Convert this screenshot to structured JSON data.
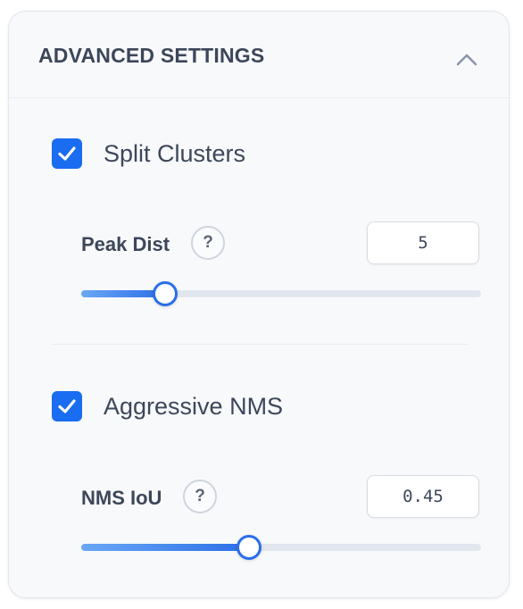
{
  "panel": {
    "title": "ADVANCED SETTINGS",
    "collapse_icon": "chevron-up-icon"
  },
  "split_clusters": {
    "label": "Split Clusters",
    "checked": true,
    "param": {
      "label": "Peak Dist",
      "help": "?",
      "value": "5",
      "slider_fraction": 0.21
    }
  },
  "aggressive_nms": {
    "label": "Aggressive NMS",
    "checked": true,
    "param": {
      "label": "NMS IoU",
      "help": "?",
      "value": "0.45",
      "slider_fraction": 0.42
    }
  },
  "colors": {
    "accent": "#1a6cf0",
    "text": "#3c475a",
    "track": "#e2e7ef"
  }
}
